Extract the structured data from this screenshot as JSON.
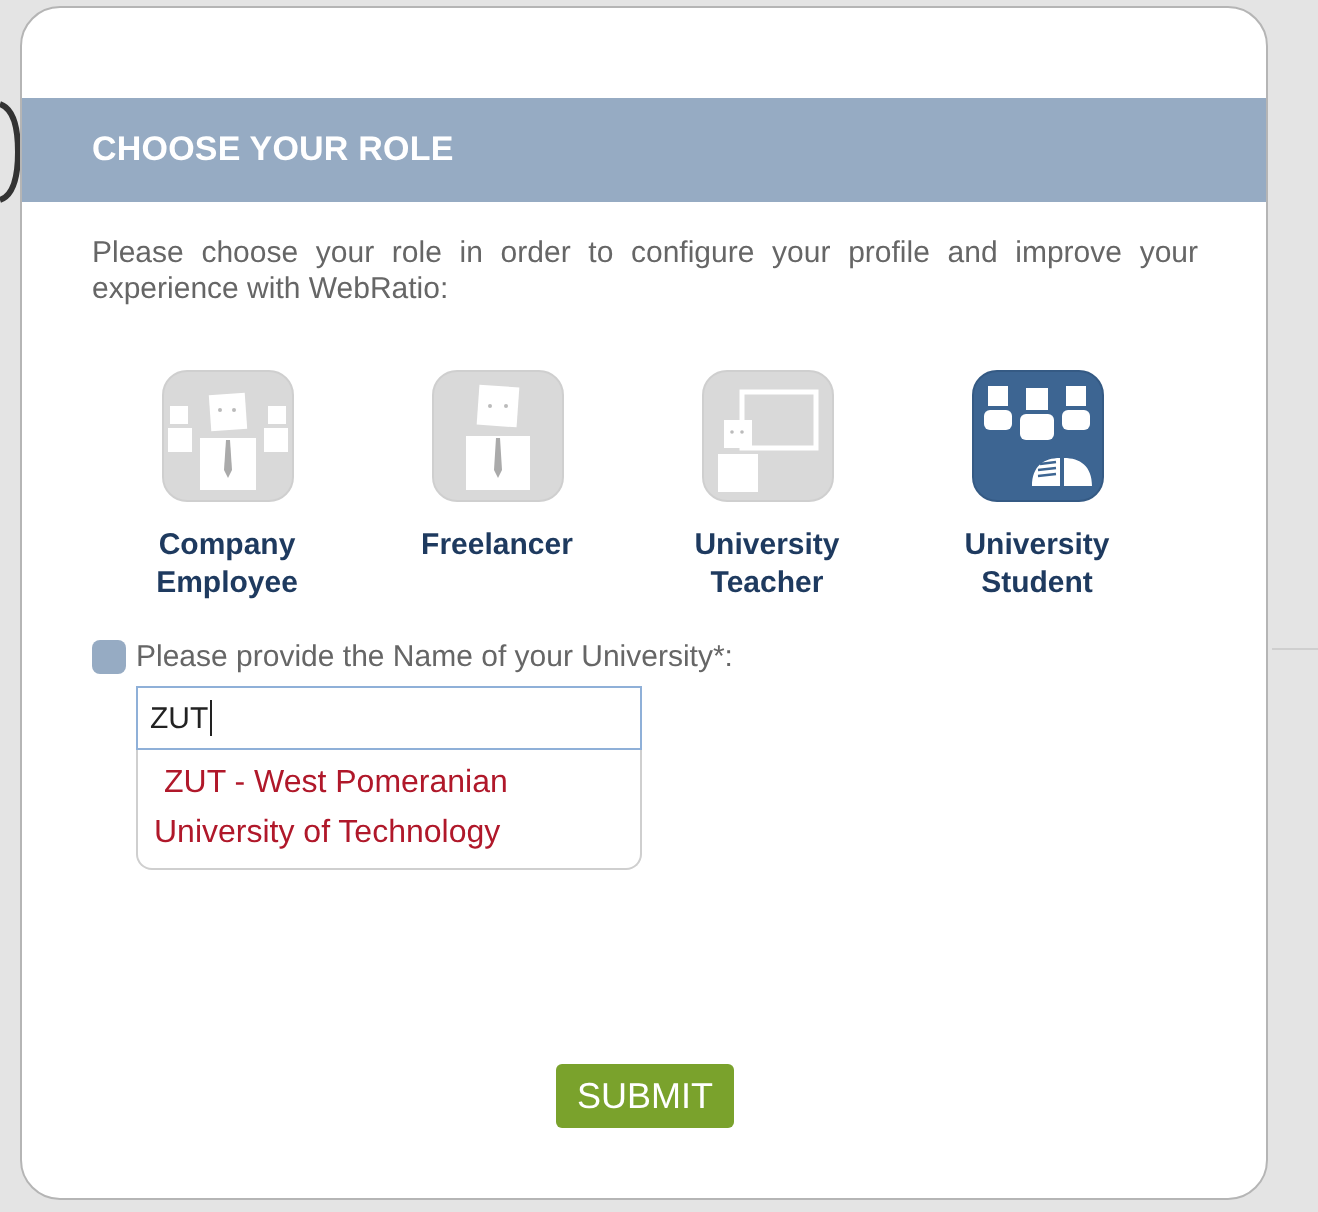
{
  "dialog": {
    "title": "CHOOSE YOUR ROLE",
    "intro": "Please choose your role in order to configure your profile and improve your experience with WebRatio:",
    "roles": [
      {
        "kind": "company",
        "label": "Company Employee",
        "selected": false
      },
      {
        "kind": "freelancer",
        "label": "Freelancer",
        "selected": false
      },
      {
        "kind": "teacher",
        "label": "University Teacher",
        "selected": false
      },
      {
        "kind": "student",
        "label": "University Student",
        "selected": true
      }
    ],
    "university_field": {
      "checked": false,
      "label": "Please provide the Name of your University*:",
      "value": "ZUT",
      "suggestions": [
        "ZUT - West Pomeranian University of Technology"
      ]
    },
    "submit": "SUBMIT"
  }
}
